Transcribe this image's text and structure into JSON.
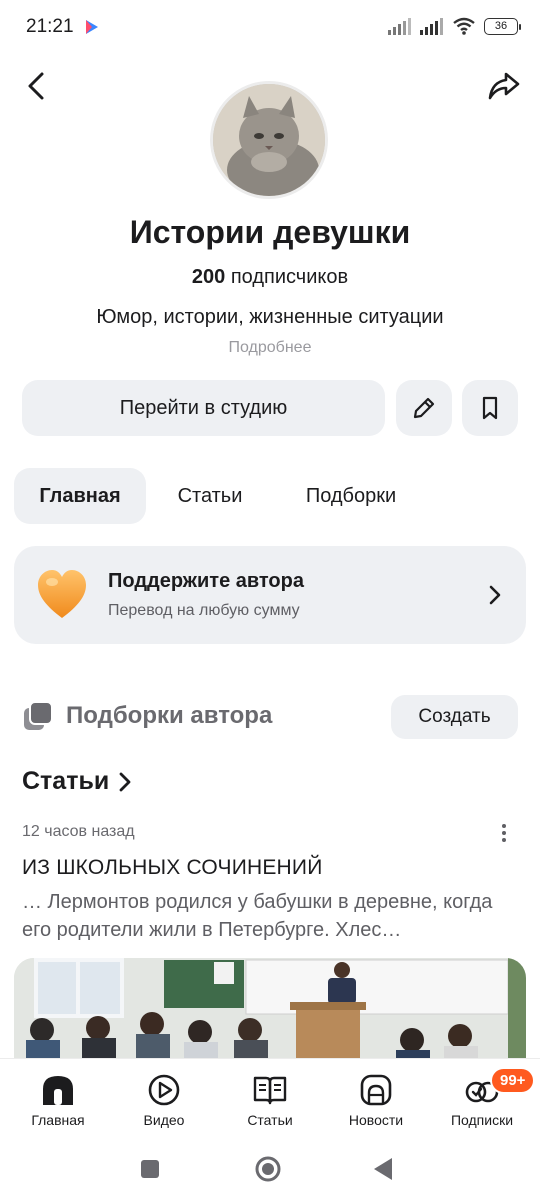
{
  "status_bar": {
    "time": "21:21",
    "battery": "36"
  },
  "header": {
    "back_icon": "chevron-left-icon",
    "share_icon": "share-arrow-icon"
  },
  "channel": {
    "title": "Истории девушки",
    "subscribers_count": "200",
    "subscribers_label": "подписчиков",
    "description": "Юмор, истории, жизненные ситуации",
    "more_link": "Подробнее"
  },
  "actions": {
    "studio_label": "Перейти в студию",
    "edit_icon": "pencil-icon",
    "bookmark_icon": "bookmark-icon"
  },
  "tabs": [
    {
      "label": "Главная",
      "active": true
    },
    {
      "label": "Статьи",
      "active": false
    },
    {
      "label": "Подборки",
      "active": false
    }
  ],
  "support": {
    "title": "Поддержите автора",
    "subtitle": "Перевод на любую сумму"
  },
  "collections": {
    "title": "Подборки автора",
    "create_label": "Создать"
  },
  "articles": {
    "heading": "Статьи",
    "item": {
      "time": "12 часов назад",
      "title": "ИЗ ШКОЛЬНЫХ СОЧИНЕНИЙ",
      "snippet": "… Лермонтов родился у бабушки в деревне, когда его родители жили в Петербурге. Хлес…"
    }
  },
  "bottom_nav": [
    {
      "label": "Главная",
      "icon": "home-icon"
    },
    {
      "label": "Видео",
      "icon": "video-play-icon"
    },
    {
      "label": "Статьи",
      "icon": "book-icon"
    },
    {
      "label": "Новости",
      "icon": "news-icon"
    },
    {
      "label": "Подписки",
      "icon": "subscriptions-icon",
      "badge": "99+"
    }
  ],
  "colors": {
    "accent_badge": "#ff5a1f",
    "button_bg": "#eef0f3"
  }
}
